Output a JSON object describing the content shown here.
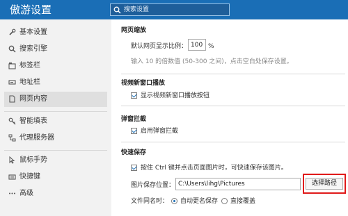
{
  "header": {
    "title": "傲游设置",
    "search_placeholder": "搜索设置"
  },
  "sidebar": {
    "items": [
      {
        "label": "基本设置",
        "icon": "wrench-icon"
      },
      {
        "label": "搜索引擎",
        "icon": "search-icon"
      },
      {
        "label": "标签栏",
        "icon": "tabs-icon"
      },
      {
        "label": "地址栏",
        "icon": "address-bar-icon"
      },
      {
        "label": "网页内容",
        "icon": "document-icon",
        "active": true
      },
      {
        "label": "智能填表",
        "icon": "key-icon"
      },
      {
        "label": "代理服务器",
        "icon": "network-icon"
      },
      {
        "label": "鼠标手势",
        "icon": "mouse-icon"
      },
      {
        "label": "快捷键",
        "icon": "keyboard-icon"
      },
      {
        "label": "高级",
        "icon": "more-icon"
      }
    ]
  },
  "zoom": {
    "title": "网页缩放",
    "label": "默认网页显示比例：",
    "value": "100",
    "unit": "%",
    "hint": "输入 10 的倍数值 (50-300 之间)，点击空白处保存设置。"
  },
  "video": {
    "title": "视频新窗口播放",
    "checkbox_label": "显示视频新窗口播放按钮"
  },
  "popup": {
    "title": "弹窗拦截",
    "checkbox_label": "启用弹窗拦截"
  },
  "quicksave": {
    "title": "快速保存",
    "checkbox_label": "按住 Ctrl 键并点击页面图片时，可快速保存该图片。",
    "path_label": "图片保存位置：",
    "path_value": "C:\\Users\\lihg\\Pictures",
    "choose_button": "选择路径",
    "dup_label": "文件同名时：",
    "option_rename": "自动更名保存",
    "option_overwrite": "直接覆盖"
  }
}
